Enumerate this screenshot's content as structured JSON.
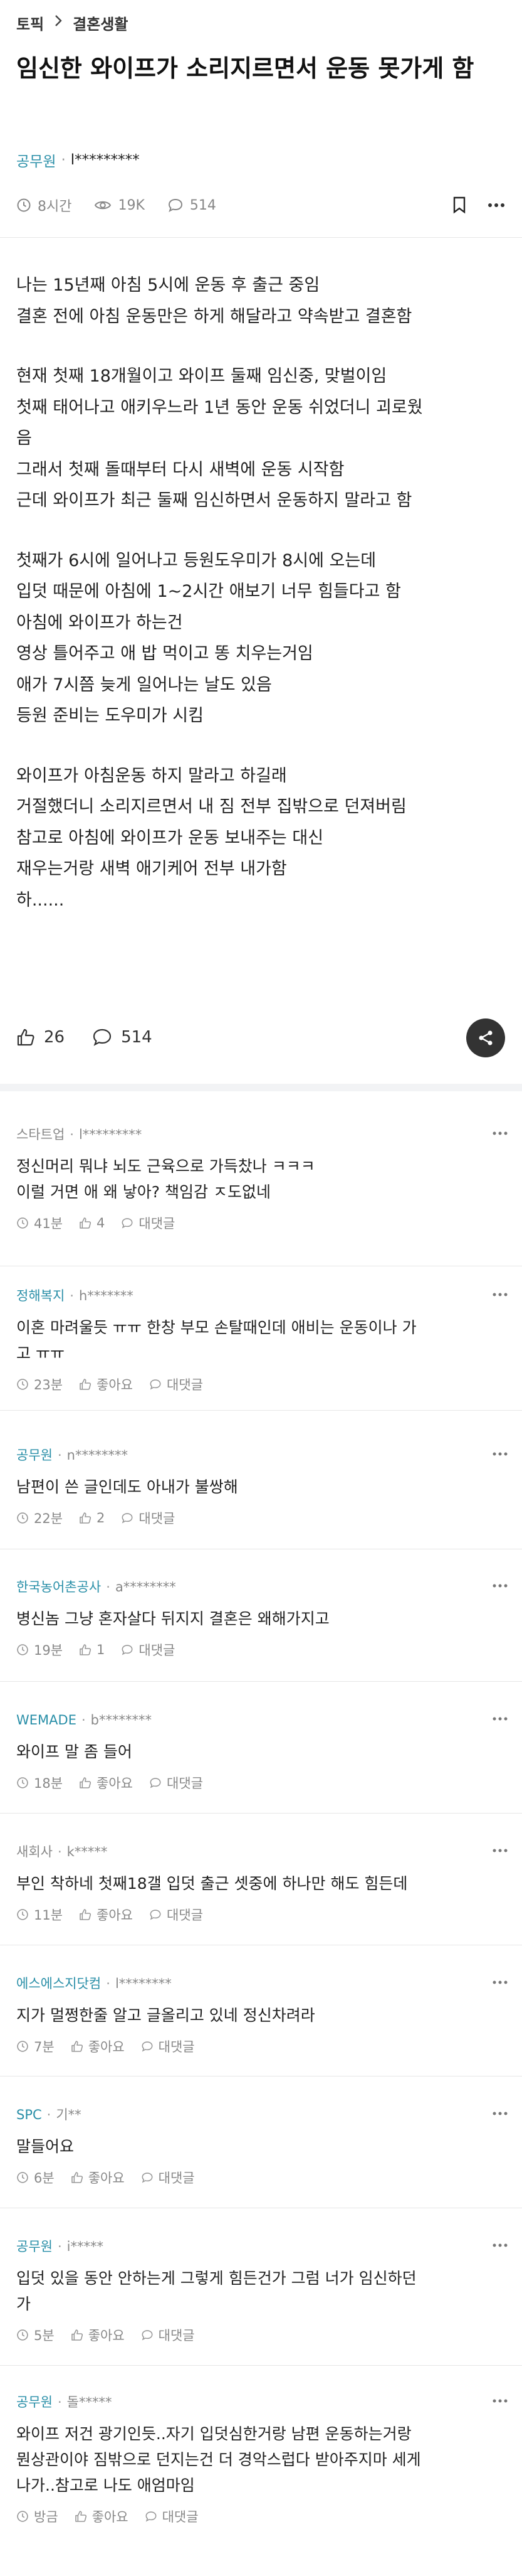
{
  "breadcrumb": {
    "topic": "토픽",
    "category": "결혼생활"
  },
  "post": {
    "title": "임신한 와이프가 소리지르면서 운동 못가게 함",
    "author_company": "공무원",
    "author_nick": "l*********",
    "time": "8시간",
    "views": "19K",
    "comments": "514",
    "body": [
      [
        "나는 15년째 아침 5시에 운동 후 출근 중임",
        "결혼 전에 아침 운동만은 하게 해달라고 약속받고 결혼함"
      ],
      [
        "현재 첫째 18개월이고 와이프 둘째 임신중, 맞벌이임",
        "첫째 태어나고 애키우느라 1년 동안 운동 쉬었더니 괴로웠",
        "음",
        "그래서 첫째 돌때부터 다시 새벽에 운동 시작함",
        "근데 와이프가 최근 둘째 임신하면서 운동하지 말라고 함"
      ],
      [
        "첫째가 6시에 일어나고 등원도우미가 8시에 오는데",
        "입덧 때문에 아침에 1~2시간 애보기 너무 힘들다고 함",
        "아침에 와이프가 하는건",
        "영상 틀어주고 애 밥 먹이고 똥 치우는거임",
        "애가 7시쯤 늦게 일어나는 날도 있음",
        "등원 준비는 도우미가 시킴"
      ],
      [
        "와이프가 아침운동 하지 말라고 하길래",
        "거절했더니 소리지르면서 내 짐 전부 집밖으로 던져버림",
        "참고로 아침에 와이프가 운동 보내주는 대신",
        "재우는거랑 새벽 애기케어 전부 내가함",
        "하......"
      ]
    ],
    "likes": "26",
    "comment_count": "514"
  },
  "labels": {
    "like": "좋아요",
    "reply": "대댓글"
  },
  "comments": [
    {
      "company": "스타트업",
      "company_gray": true,
      "nick": "l*********",
      "lines": [
        "정신머리 뭐냐 뇌도 근육으로 가득찼나 ㅋㅋㅋ",
        "이럴 거면 애 왜 낳아? 책임감 ㅈ도없네"
      ],
      "time": "41분",
      "likes": "4"
    },
    {
      "company": "정해복지",
      "nick": "h*******",
      "lines": [
        "이혼 마려울듯 ㅠㅠ 한창 부모 손탈때인데 애비는 운동이나 가",
        "고 ㅠㅠ"
      ],
      "time": "23분",
      "likes": "좋아요"
    },
    {
      "company": "공무원",
      "nick": "n********",
      "lines": [
        "남편이 쓴 글인데도 아내가 불쌍해"
      ],
      "time": "22분",
      "likes": "2"
    },
    {
      "company": "한국농어촌공사",
      "nick": "a********",
      "lines": [
        "병신놈 그냥 혼자살다 뒤지지 결혼은 왜해가지고"
      ],
      "time": "19분",
      "likes": "1"
    },
    {
      "company": "WEMADE",
      "nick": "b********",
      "lines": [
        "와이프 말 좀 들어"
      ],
      "time": "18분",
      "likes": "좋아요"
    },
    {
      "company": "새회사",
      "company_gray": true,
      "nick": "k*****",
      "lines": [
        "부인 착하네 첫째18갤 입덧 출근 셋중에 하나만 해도 힘든데"
      ],
      "time": "11분",
      "likes": "좋아요"
    },
    {
      "company": "에스에스지닷컴",
      "nick": "l********",
      "lines": [
        "지가 멀쩡한줄 알고 글올리고 있네 정신차려라"
      ],
      "time": "7분",
      "likes": "좋아요"
    },
    {
      "company": "SPC",
      "nick": "기**",
      "lines": [
        "말들어요"
      ],
      "time": "6분",
      "likes": "좋아요"
    },
    {
      "company": "공무원",
      "nick": "i*****",
      "lines": [
        "입덧 있을 동안 안하는게 그렇게 힘든건가 그럼 너가 임신하던",
        "가"
      ],
      "time": "5분",
      "likes": "좋아요"
    },
    {
      "company": "공무원",
      "nick": "돌*****",
      "lines": [
        "와이프 저건 광기인듯..자기 입덧심한거랑 남편 운동하는거랑",
        "뭔상관이야 짐밖으로 던지는건 더 경악스럽다 받아주지마 세게",
        "나가..참고로 나도 애엄마임"
      ],
      "time": "방금",
      "likes": "좋아요"
    }
  ]
}
